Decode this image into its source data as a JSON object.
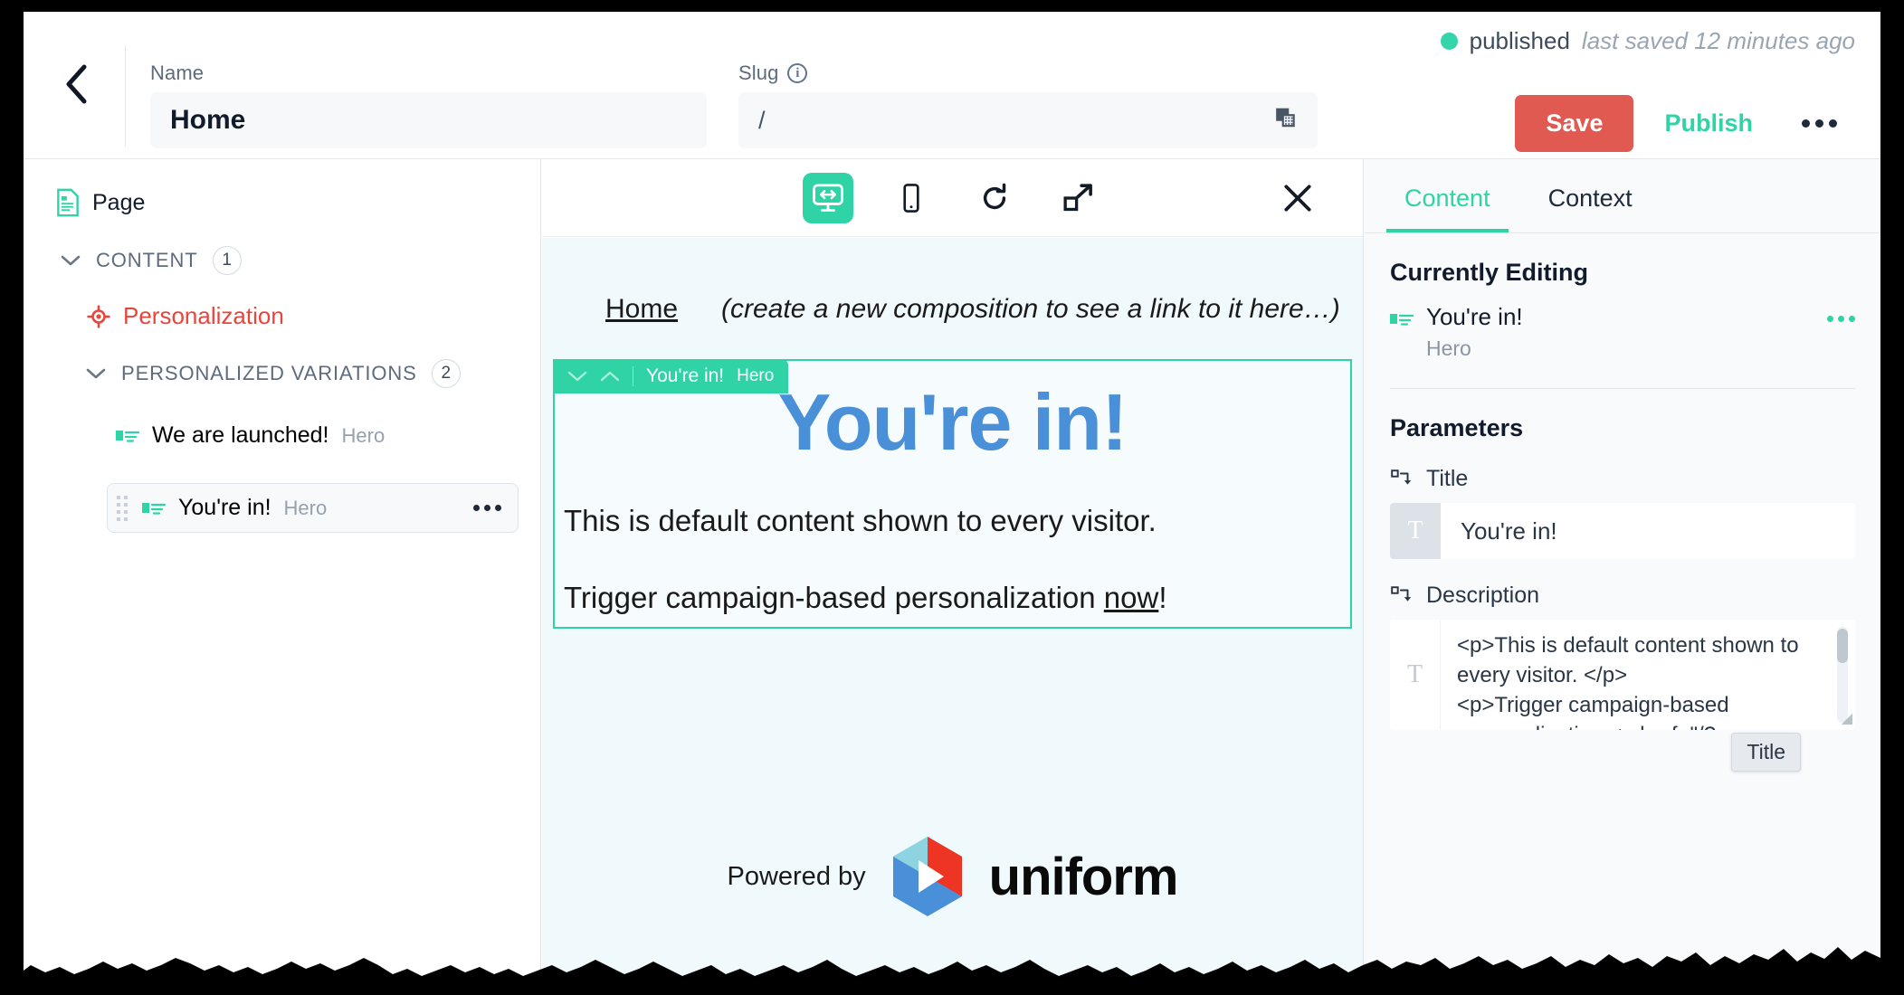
{
  "header": {
    "back_icon": "chevron-left-icon",
    "name_label": "Name",
    "name_value": "Home",
    "slug_label": "Slug",
    "slug_info_icon": "info-icon",
    "slug_value": "/",
    "copy_icon": "copy-icon",
    "status": "published",
    "last_saved": "last saved 12 minutes ago",
    "save_label": "Save",
    "publish_label": "Publish",
    "more_icon": "ellipsis-icon"
  },
  "sidebar": {
    "page_label": "Page",
    "page_icon": "document-icon",
    "content_label": "CONTENT",
    "content_count": "1",
    "personalization_label": "Personalization",
    "personalization_icon": "target-icon",
    "variations_label": "PERSONALIZED VARIATIONS",
    "variations_count": "2",
    "variations": [
      {
        "title": "We are launched!",
        "type": "Hero",
        "selected": false
      },
      {
        "title": "You're in!",
        "type": "Hero",
        "selected": true
      }
    ]
  },
  "preview": {
    "toolbar": {
      "desktop_icon": "desktop-responsive-icon",
      "mobile_icon": "mobile-device-icon",
      "refresh_icon": "refresh-icon",
      "expand_icon": "open-external-icon",
      "close_icon": "close-icon"
    },
    "nav_home": "Home",
    "nav_note": "(create a new composition to see a link to it here…)",
    "component_tab": {
      "down_icon": "chevron-down-icon",
      "up_icon": "chevron-up-icon",
      "title": "You're in!",
      "type": "Hero"
    },
    "hero_title": "You're in!",
    "hero_paragraph_1": "This is default content shown to every visitor.",
    "hero_paragraph_2_prefix": "Trigger campaign-based personalization ",
    "hero_paragraph_2_link": "now",
    "hero_paragraph_2_suffix": "!",
    "footer_powered": "Powered by",
    "footer_brand": "uniform"
  },
  "right_panel": {
    "tabs": [
      {
        "label": "Content",
        "active": true
      },
      {
        "label": "Context",
        "active": false
      }
    ],
    "currently_editing_heading": "Currently Editing",
    "editing_item_title": "You're in!",
    "editing_item_type": "Hero",
    "editing_more_icon": "ellipsis-icon",
    "parameters_heading": "Parameters",
    "title_param_label": "Title",
    "title_param_icon": "text-type-icon",
    "title_param_value": "You're in!",
    "description_param_label": "Description",
    "description_param_icon": "text-type-icon",
    "description_param_value": "<p>This is default content shown to every visitor. </p>\n<p>Trigger campaign-based personalization <a href=\"/?",
    "tooltip_text": "Title"
  },
  "colors": {
    "accent_green": "#2fd3a6",
    "save_red": "#e05a52",
    "personalization_red": "#e8463c",
    "hero_blue": "#4a90d9",
    "preview_bg": "#f0f9fc"
  }
}
